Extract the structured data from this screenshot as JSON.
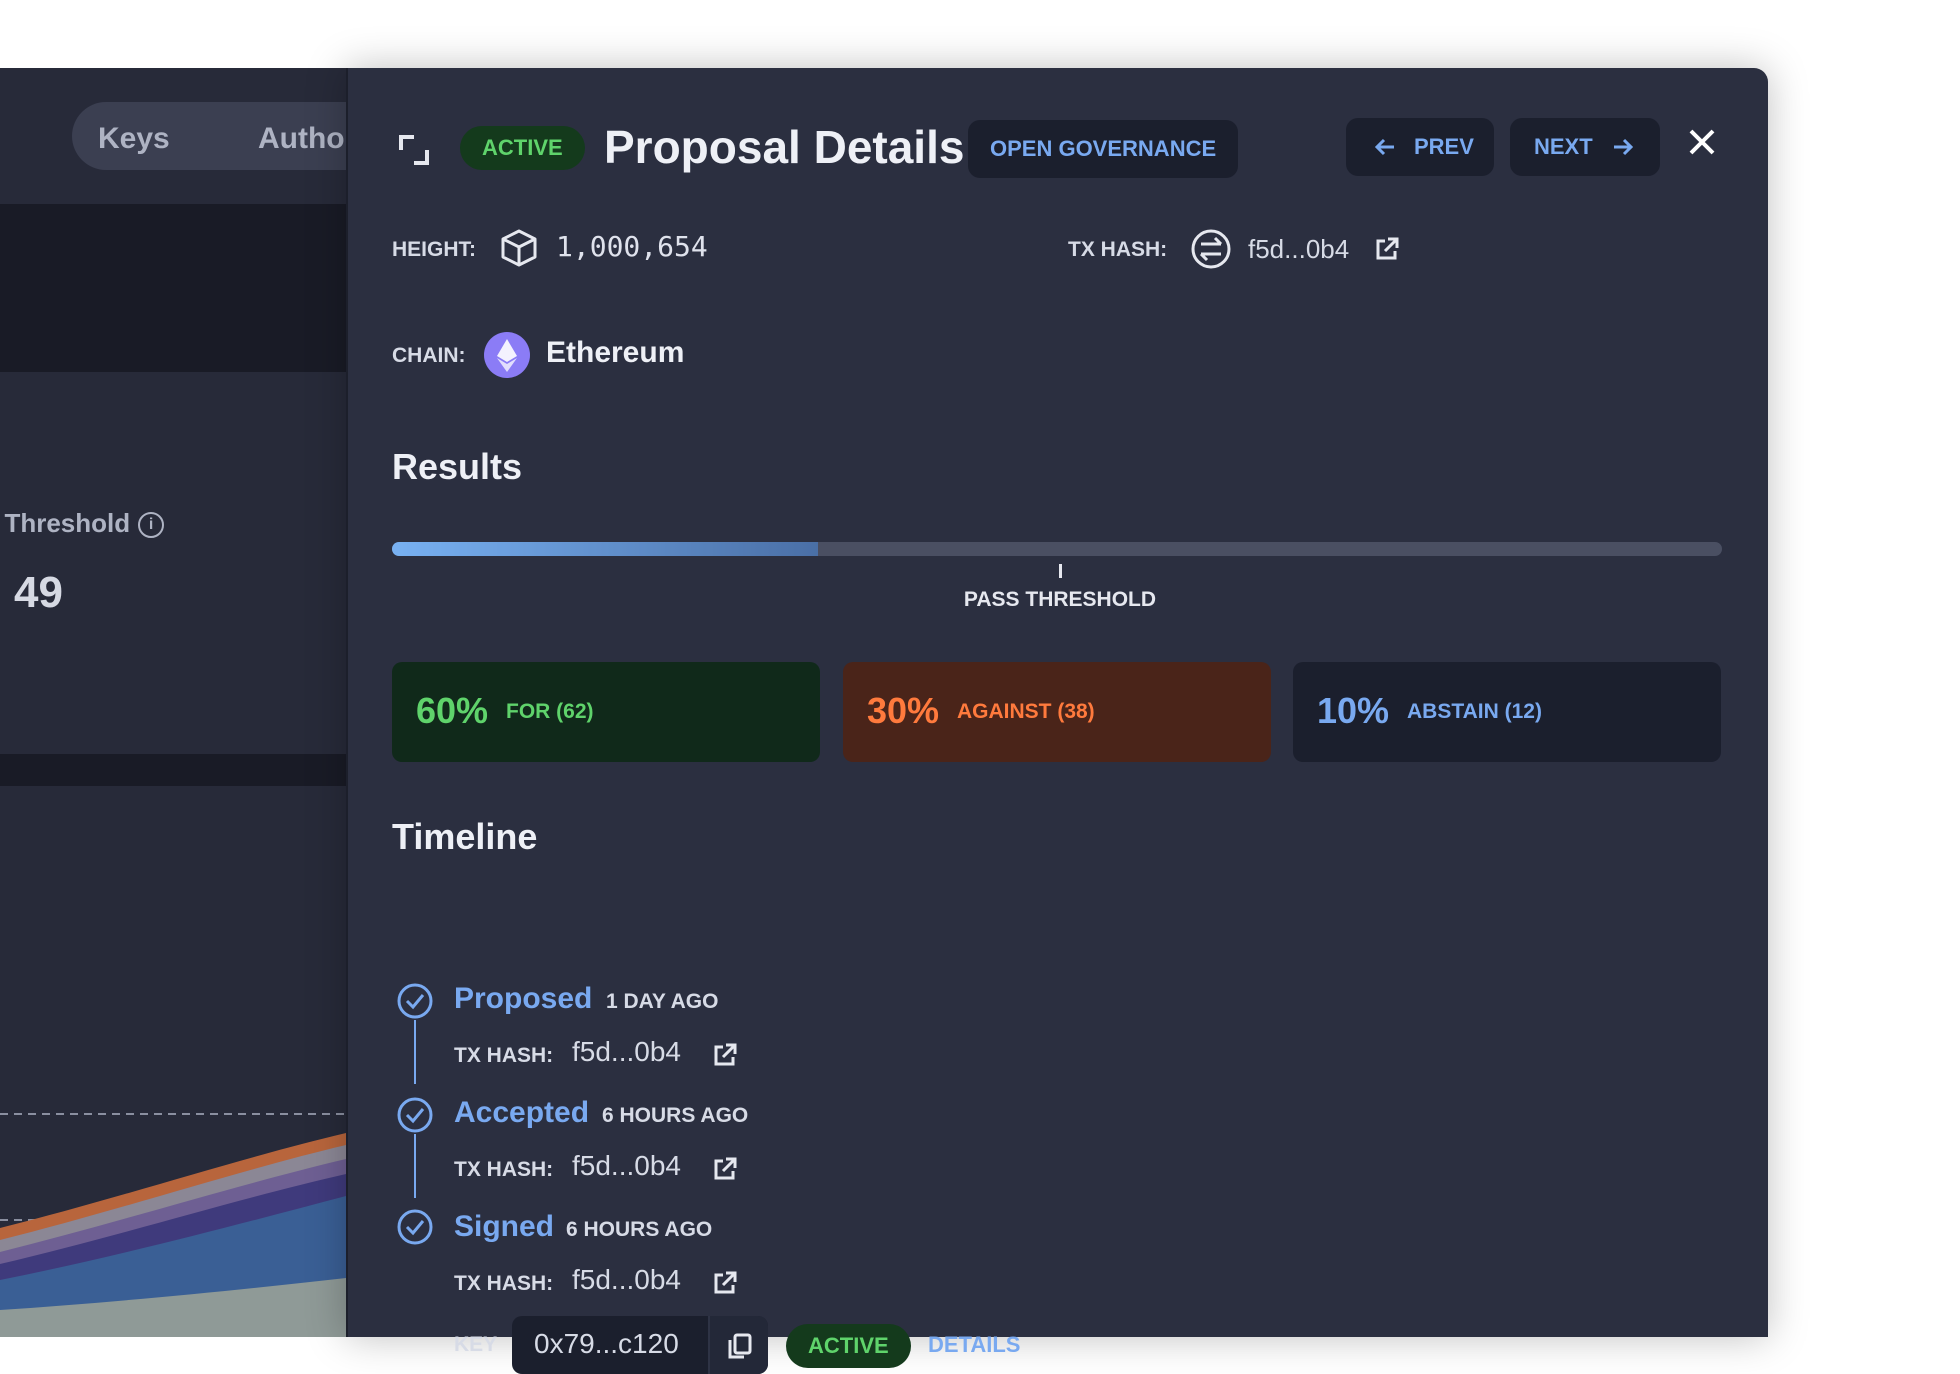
{
  "background_app": {
    "tabs": [
      "Keys",
      "Autho"
    ],
    "threshold_label": "l Threshold",
    "value": "49"
  },
  "panel": {
    "status": "ACTIVE",
    "title": "Proposal Details",
    "open_governance": "OPEN GOVERNANCE",
    "prev": "PREV",
    "next": "NEXT",
    "height_label": "HEIGHT:",
    "height_value": "1,000,654",
    "tx_hash_label": "TX HASH:",
    "tx_hash_value": "f5d...0b4",
    "chain_label": "CHAIN:",
    "chain_value": "Ethereum",
    "results_title": "Results",
    "results_progress_fraction": 0.32,
    "pass_threshold_label": "PASS THRESHOLD",
    "cards": [
      {
        "pct": "60%",
        "desc": "FOR (62)"
      },
      {
        "pct": "30%",
        "desc": "AGAINST (38)"
      },
      {
        "pct": "10%",
        "desc": "ABSTAIN (12)"
      }
    ],
    "timeline_title": "Timeline",
    "timeline": [
      {
        "title": "Proposed",
        "ago": "1 DAY AGO",
        "hash_label": "TX HASH:",
        "hash": "f5d...0b4"
      },
      {
        "title": "Accepted",
        "ago": "6 HOURS AGO",
        "hash_label": "TX HASH:",
        "hash": "f5d...0b4"
      },
      {
        "title": "Signed",
        "ago": "6 HOURS AGO",
        "hash_label": "TX HASH:",
        "hash": "f5d...0b4"
      }
    ],
    "key_label": "KEY",
    "key_value": "0x79...c120",
    "key_status": "ACTIVE",
    "details_link": "DETAILS"
  },
  "colors": {
    "accent_blue": "#79a9f0",
    "active_green": "#5fd36b",
    "for_bg": "#10291a",
    "against_bg": "#4a2419",
    "abstain_bg": "#1b1f2d",
    "ethereum": "#8b7cf6"
  },
  "icons": {
    "expand": "expand-icon",
    "close": "close-icon",
    "cube": "cube-icon",
    "exchange": "exchange-icon",
    "external": "external-link-icon",
    "check": "check-circle-icon",
    "copy": "copy-icon",
    "ethereum": "ethereum-icon"
  }
}
